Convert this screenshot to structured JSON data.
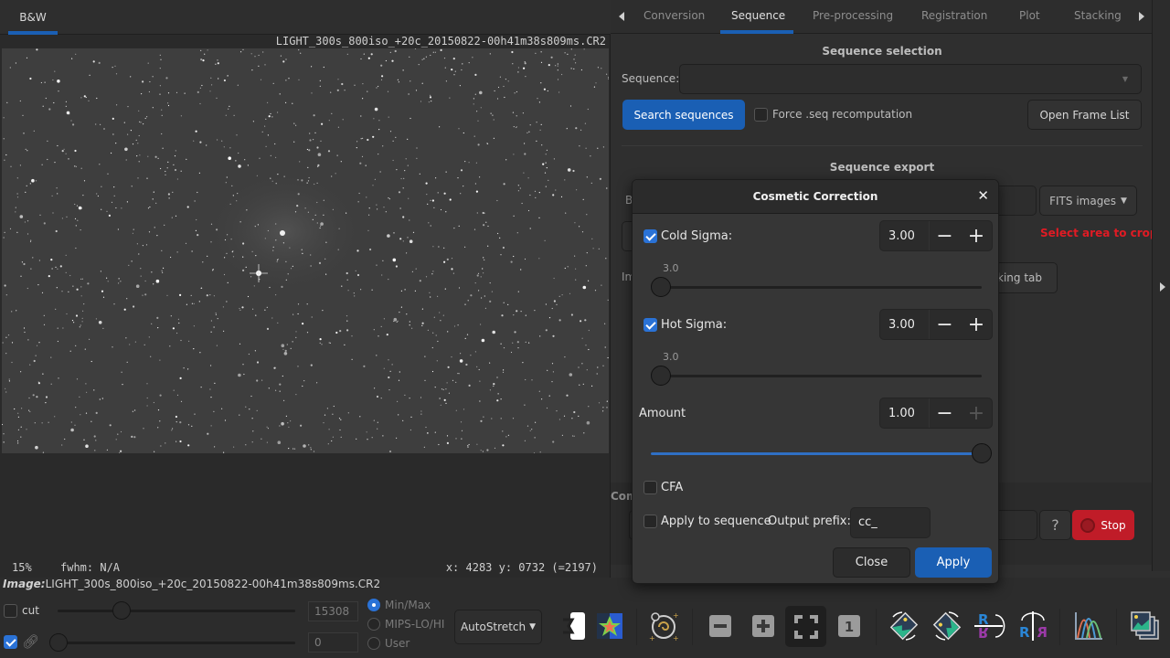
{
  "left_panel": {
    "tab_label": "B&W",
    "image_filename": "LIGHT_300s_800iso_+20c_20150822-00h41m38s809ms.CR2",
    "zoom": "15%",
    "fwhm": "fwhm: N/A",
    "coords": "x: 4283 y: 0732 (=2197)",
    "image_line_label": "Image:",
    "image_line_value": "LIGHT_300s_800iso_+20c_20150822-00h41m38s809ms.CR2"
  },
  "bottom_bar": {
    "cut_label": "cut",
    "cut_checked": false,
    "link_checked": true,
    "high_value": "15308",
    "low_value": "0",
    "high_slider_fraction": 0.3,
    "low_slider_fraction": 0.0,
    "radio_options": [
      {
        "label": "Min/Max",
        "selected": true
      },
      {
        "label": "MIPS-LO/HI",
        "selected": false
      },
      {
        "label": "User",
        "selected": false
      }
    ],
    "stretch_mode": "AutoStretch",
    "tools": [
      {
        "name": "photometry-icon"
      },
      {
        "name": "star-detection-icon"
      },
      {
        "name": "galaxy-annotate-icon"
      },
      {
        "name": "zoom-out-icon"
      },
      {
        "name": "zoom-in-icon"
      },
      {
        "name": "zoom-fit-icon"
      },
      {
        "name": "zoom-one-icon",
        "label": "1"
      },
      {
        "name": "rotate-left-icon"
      },
      {
        "name": "rotate-right-icon"
      },
      {
        "name": "mirror-x-icon",
        "label": "R"
      },
      {
        "name": "mirror-y-icon",
        "label": "R"
      },
      {
        "name": "histogram-icon"
      },
      {
        "name": "image-stack-icon"
      }
    ]
  },
  "right_panel": {
    "tabs": [
      {
        "label": "Conversion",
        "active": false
      },
      {
        "label": "Sequence",
        "active": true
      },
      {
        "label": "Pre-processing",
        "active": false
      },
      {
        "label": "Registration",
        "active": false
      },
      {
        "label": "Plot",
        "active": false
      },
      {
        "label": "Stacking",
        "active": false
      }
    ],
    "sequence_selection_title": "Sequence selection",
    "sequence_label": "Sequence:",
    "sequence_value": "",
    "search_button": "Search sequences",
    "force_recompute_label": "Force .seq recomputation",
    "force_recompute_checked": false,
    "open_frame_list": "Open Frame List",
    "sequence_export_title": "Sequence export",
    "export_format": "FITS images",
    "crop_hint": "Select area to crop",
    "stacking_tab_button_partial": "king tab",
    "partial_b": "B",
    "partial_im": "Im",
    "partial_con": "Com",
    "help_button": "?",
    "stop_button": "Stop"
  },
  "dialog": {
    "title": "Cosmetic Correction",
    "cold_sigma": {
      "label": "Cold Sigma:",
      "checked": true,
      "value": "3.00",
      "slider_label": "3.0",
      "slider_fraction": 0.03
    },
    "hot_sigma": {
      "label": "Hot Sigma:",
      "checked": true,
      "value": "3.00",
      "slider_label": "3.0",
      "slider_fraction": 0.03
    },
    "amount": {
      "label": "Amount",
      "value": "1.00",
      "slider_fraction": 1.0
    },
    "cfa": {
      "label": "CFA",
      "checked": false
    },
    "apply_to_sequence": {
      "label": "Apply to sequence",
      "checked": false
    },
    "output_prefix_label": "Output prefix:",
    "output_prefix_value": "cc_",
    "close_button": "Close",
    "apply_button": "Apply",
    "accent": "#1a5fb4"
  }
}
